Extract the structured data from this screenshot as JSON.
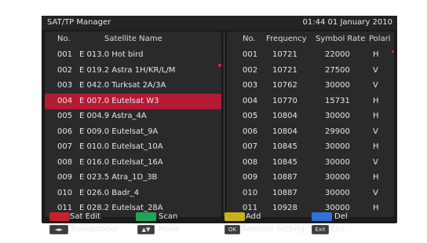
{
  "window": {
    "title": "SAT/TP Manager",
    "clock": "01:44 01 January 2010"
  },
  "satellite_list": {
    "headers": {
      "no": "No.",
      "name": "Satellite Name"
    },
    "rows": [
      {
        "no": "001",
        "name": "E 013.0 Hot bird"
      },
      {
        "no": "002",
        "name": "E 019.2 Astra 1H/KR/L/M"
      },
      {
        "no": "003",
        "name": "E 042.0 Turksat 2A/3A"
      },
      {
        "no": "004",
        "name": "E 007.0 Eutelsat W3"
      },
      {
        "no": "005",
        "name": "E 004.9 Astra_4A"
      },
      {
        "no": "006",
        "name": "E 009.0 Eutelsat_9A"
      },
      {
        "no": "007",
        "name": "E 010.0 Eutelsat_10A"
      },
      {
        "no": "008",
        "name": "E 016.0 Eutelsat_16A"
      },
      {
        "no": "009",
        "name": "E 023.5 Atra_1D_3B"
      },
      {
        "no": "010",
        "name": "E 026.0 Badr_4"
      },
      {
        "no": "011",
        "name": "E 028.2 Eutelsat_28A"
      }
    ],
    "selected_index": 3
  },
  "transponder_list": {
    "headers": {
      "no": "No.",
      "frequency": "Frequency",
      "symbol_rate": "Symbol Rate",
      "polarity": "Polari"
    },
    "rows": [
      {
        "no": "001",
        "frequency": "10721",
        "symbol_rate": "22000",
        "polarity": "H"
      },
      {
        "no": "002",
        "frequency": "10721",
        "symbol_rate": "27500",
        "polarity": "V"
      },
      {
        "no": "003",
        "frequency": "10762",
        "symbol_rate": "30000",
        "polarity": "V"
      },
      {
        "no": "004",
        "frequency": "10770",
        "symbol_rate": "15731",
        "polarity": "H"
      },
      {
        "no": "005",
        "frequency": "10804",
        "symbol_rate": "30000",
        "polarity": "H"
      },
      {
        "no": "006",
        "frequency": "10804",
        "symbol_rate": "29900",
        "polarity": "V"
      },
      {
        "no": "007",
        "frequency": "10845",
        "symbol_rate": "30000",
        "polarity": "H"
      },
      {
        "no": "008",
        "frequency": "10845",
        "symbol_rate": "30000",
        "polarity": "V"
      },
      {
        "no": "009",
        "frequency": "10887",
        "symbol_rate": "30000",
        "polarity": "H"
      },
      {
        "no": "010",
        "frequency": "10887",
        "symbol_rate": "30000",
        "polarity": "V"
      },
      {
        "no": "011",
        "frequency": "10928",
        "symbol_rate": "30000",
        "polarity": "H"
      }
    ]
  },
  "legend": {
    "red": {
      "label": "Sat Edit",
      "color": "#c8202b"
    },
    "green": {
      "label": "Scan",
      "color": "#1fa558"
    },
    "yellow": {
      "label": "Add",
      "color": "#c8b21a"
    },
    "blue": {
      "label": "Del",
      "color": "#2f72d8"
    },
    "transponder": {
      "key": "◄►",
      "label": "Transponder"
    },
    "move": {
      "key": "▲▼",
      "label": "Move"
    },
    "ok": {
      "key": "OK",
      "label": "Satellite Setting"
    },
    "exit": {
      "key": "Exit",
      "label": "Exit"
    }
  }
}
